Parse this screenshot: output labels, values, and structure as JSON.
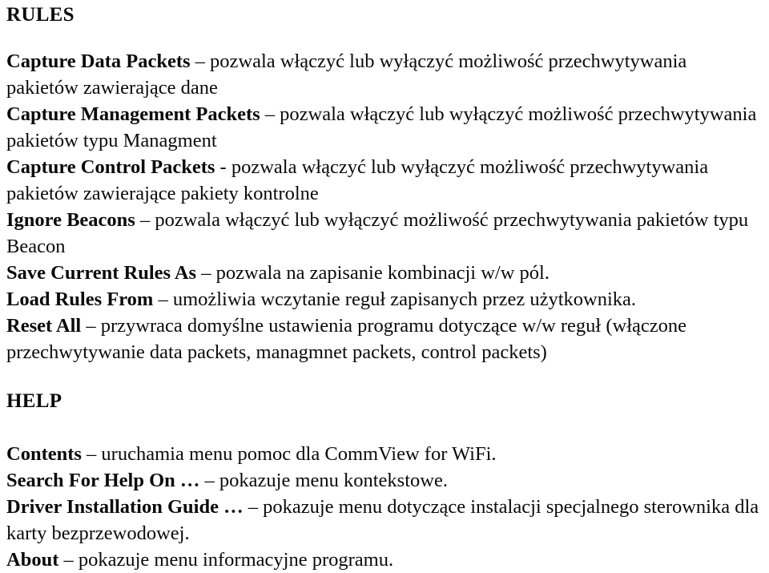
{
  "document": {
    "sections": [
      {
        "id": "rules",
        "heading": "RULES",
        "entries": [
          {
            "term": "Capture Data Packets",
            "term_suffix": "",
            "separator": "–",
            "description": "pozwala włączyć lub wyłączyć możliwość przechwytywania pakietów zawierające dane"
          },
          {
            "term": "Capture Management Packets",
            "term_suffix": "",
            "separator": "–",
            "description": "pozwala włączyć lub wyłączyć możliwość przechwytywania pakietów typu Managment"
          },
          {
            "term": "Capture Control Packets",
            "term_suffix": "",
            "separator": "-",
            "description": "pozwala włączyć lub wyłączyć możliwość przechwytywania pakietów zawierające pakiety kontrolne"
          },
          {
            "term": "Ignore Beacons",
            "term_suffix": "",
            "separator": "–",
            "description": "pozwala włączyć lub wyłączyć możliwość przechwytywania pakietów typu Beacon"
          },
          {
            "term": "Save Current Rules As",
            "term_suffix": "",
            "separator": "–",
            "description": "pozwala na zapisanie kombinacji w/w pól."
          },
          {
            "term": "Load Rules From",
            "term_suffix": "",
            "separator": "–",
            "description": "umożliwia wczytanie reguł zapisanych przez użytkownika."
          },
          {
            "term": "Reset All",
            "term_suffix": "",
            "separator": "–",
            "description": "przywraca domyślne ustawienia programu dotyczące w/w reguł (włączone przechwytywanie data packets, managmnet packets, control packets)"
          }
        ]
      },
      {
        "id": "help",
        "heading": "HELP",
        "entries": [
          {
            "term": "Contents",
            "term_suffix": "",
            "separator": "–",
            "description": "uruchamia menu pomoc dla CommView for WiFi."
          },
          {
            "term": "Search For Help On",
            "term_suffix": "…",
            "separator": "–",
            "description": "pokazuje menu kontekstowe."
          },
          {
            "term": "Driver Installation Guide",
            "term_suffix": "…",
            "separator": "–",
            "description": "pokazuje menu dotyczące instalacji specjalnego sterownika dla karty bezprzewodowej."
          },
          {
            "term": "About",
            "term_suffix": "",
            "separator": "–",
            "description": "pokazuje menu informacyjne programu."
          }
        ]
      }
    ]
  }
}
